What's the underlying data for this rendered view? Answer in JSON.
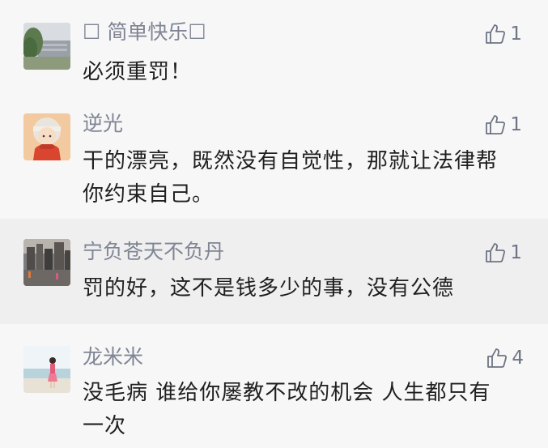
{
  "comments": [
    {
      "nickname": "☐ 简单快乐☐",
      "likes": "1",
      "text": "必须重罚！",
      "avatar_icon": "landscape-tree-avatar"
    },
    {
      "nickname": "逆光",
      "likes": "1",
      "text": "干的漂亮，既然没有自觉性，那就让法律帮你约束自己。",
      "avatar_icon": "illustrated-girl-avatar"
    },
    {
      "nickname": "宁负苍天不负丹",
      "likes": "1",
      "text": "罚的好，这不是钱多少的事，没有公德",
      "avatar_icon": "city-night-avatar"
    },
    {
      "nickname": "龙米米",
      "likes": "4",
      "text": "没毛病 谁给你屡教不改的机会 人生都只有一次",
      "avatar_icon": "beach-person-avatar"
    }
  ],
  "icons": {
    "like": "thumbs-up-icon"
  },
  "colors": {
    "nickname": "#7f8594",
    "text": "#1f1f1f",
    "like": "#6d7483",
    "background": "#f7f7f7",
    "highlight_row": "#efefef"
  }
}
